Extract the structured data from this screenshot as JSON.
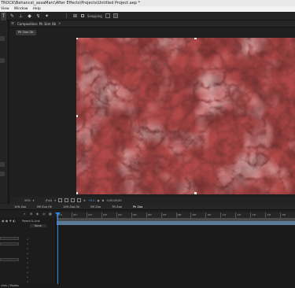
{
  "app": {
    "title": "TROCK\\Behance\\_assaMarc\\After Effects\\Projects\\Untitled Project.aep *"
  },
  "menu": [
    "View",
    "Window",
    "Help"
  ],
  "toolbar": {
    "snapping_label": "Snapping",
    "tool_icons": [
      "type-tool-icon",
      "brush-tool-icon",
      "clone-stamp-icon",
      "eraser-icon",
      "roto-brush-icon",
      "puppet-pin-icon"
    ]
  },
  "composition": {
    "tab_label": "Composition: Ph 1km Ok",
    "subtab_label": "Ph 1km Ok",
    "view_colors": {
      "background": "#8a2b2b",
      "highlight": "#f2d2d2",
      "vein": "#4a0c0c"
    }
  },
  "viewer_controls": {
    "zoom": "50%",
    "resolution": "(Full)",
    "timecode": "0;00;00;00",
    "exposure": "+0.0"
  },
  "timeline": {
    "tabs": [
      "10ft Zoo",
      "Bfl Zoo Ok",
      "10ft Zoo Ok",
      "Bfl Zoo",
      "7ft Zoo",
      "Ph Zoo"
    ],
    "current_tab_index": 5,
    "parent_link_label": "Parent & Link",
    "parent_value": "None",
    "ruler_ticks": [
      "0:0",
      "01f",
      "02f",
      "03f",
      "04f",
      "05f",
      "06f",
      "07f",
      "08f",
      "09f",
      "10f",
      "11f",
      "12f",
      "13f",
      "14f",
      "15f"
    ]
  },
  "status": {
    "label": "ches / Modes"
  }
}
